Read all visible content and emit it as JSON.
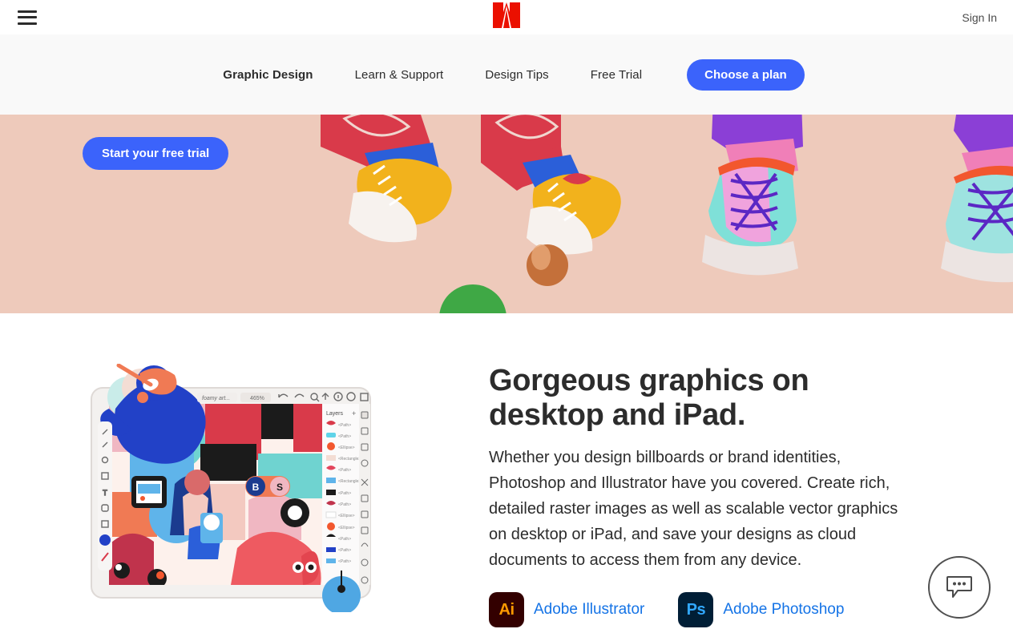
{
  "topbar": {
    "menu_icon": "hamburger-menu-icon",
    "logo": "adobe-logo",
    "signin_label": "Sign In"
  },
  "subnav": {
    "items": [
      {
        "label": "Graphic Design",
        "active": true
      },
      {
        "label": "Learn & Support",
        "active": false
      },
      {
        "label": "Design Tips",
        "active": false
      },
      {
        "label": "Free Trial",
        "active": false
      }
    ],
    "cta_label": "Choose a plan"
  },
  "hero": {
    "cta_label": "Start your free trial",
    "background_color": "#eecabb",
    "art_description": "three-pairs-of-colorful-sneakers-with-floating-spheres"
  },
  "main": {
    "headline": "Gorgeous graphics on desktop and iPad.",
    "body": "Whether you design billboards or brand identities, Photoshop and Illustrator have you covered. Create rich, detailed raster images as well as scalable vector graphics on desktop or iPad, and save your designs as cloud documents to access them from any device.",
    "products": [
      {
        "icon_text": "Ai",
        "name": "Adobe Illustrator",
        "icon_bg": "#330000",
        "icon_fg": "#ff9a00"
      },
      {
        "icon_text": "Ps",
        "name": "Adobe Photoshop",
        "icon_bg": "#001e36",
        "icon_fg": "#31a8ff"
      }
    ],
    "illustration": {
      "app_panel_title": "Layers",
      "doc_name": "foamy art...",
      "zoom_level": "465%"
    }
  },
  "chat": {
    "icon": "chat-bubble-icon"
  },
  "colors": {
    "accent_blue": "#3b63fb",
    "link_blue": "#1473e6",
    "adobe_red": "#eb1000",
    "subnav_bg": "#f9f9f9",
    "text": "#2c2c2c"
  }
}
